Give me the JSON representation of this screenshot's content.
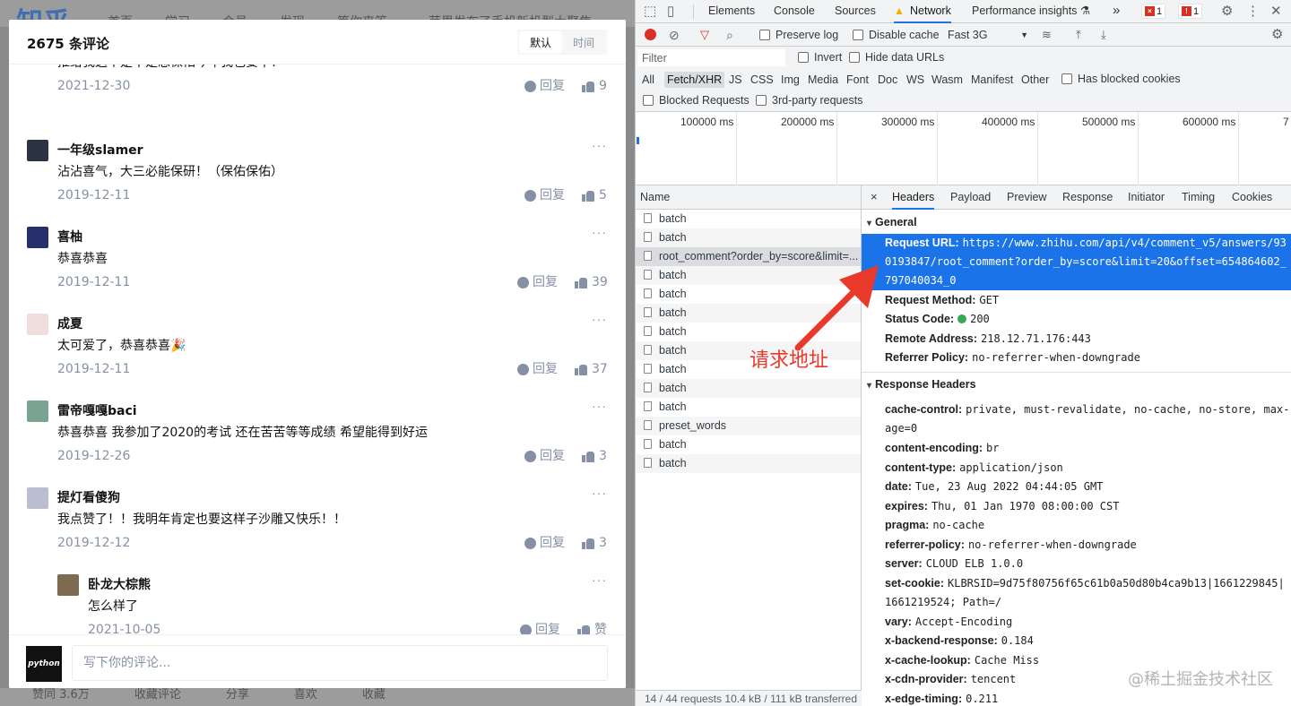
{
  "zhihu_bg": {
    "logo": "知乎",
    "nav": [
      "首页",
      "学习",
      "会员",
      "发现",
      "等你来答"
    ],
    "search_hint": "苹果发布了手机新机型大聚焦",
    "bottom": [
      "赞同 3.6万",
      "收藏评论",
      "分享",
      "喜欢",
      "收藏"
    ]
  },
  "comments_modal": {
    "title": "2675 条评论",
    "sort_default": "默认",
    "sort_time": "时间",
    "more": "···",
    "reply_label": "回复",
    "comments": [
      {
        "name": "",
        "text": "推给我这个是不是想保佑今年我也要中！",
        "date": "2021-12-30",
        "likes": "9",
        "avatar_color": "#ffffff"
      },
      {
        "name": "一年级slamer",
        "text": "沾沾喜气，大三必能保研！（保佑保佑）",
        "date": "2019-12-11",
        "likes": "5",
        "avatar_color": "#2b3240"
      },
      {
        "name": "喜柚",
        "text": "恭喜恭喜",
        "date": "2019-12-11",
        "likes": "39",
        "avatar_color": "#27306b"
      },
      {
        "name": "成夏",
        "text": "太可爱了，恭喜恭喜🎉",
        "date": "2019-12-11",
        "likes": "37",
        "avatar_color": "#f0dede"
      },
      {
        "name": "雷帝嘎嘎baci",
        "text": "恭喜恭喜 我参加了2020的考试 还在苦苦等等成绩 希望能得到好运",
        "date": "2019-12-26",
        "likes": "3",
        "avatar_color": "#7aa391"
      },
      {
        "name": "提灯看傻狗",
        "text": "我点赞了！！我明年肯定也要这样子沙雕又快乐！！",
        "date": "2019-12-12",
        "likes": "3",
        "avatar_color": "#b9bfd0"
      },
      {
        "name": "卧龙大棕熊",
        "text": "怎么样了",
        "date": "2021-10-05",
        "likes": "赞",
        "avatar_color": "#7d6a50"
      }
    ],
    "my_avatar_text": "python",
    "input_placeholder": "写下你的评论..."
  },
  "devtools": {
    "tabs": [
      "Elements",
      "Console",
      "Sources",
      "Network",
      "Performance insights ⚗"
    ],
    "active_tab": "Network",
    "overflow": "»",
    "errors": "1",
    "issues": "1",
    "toolbar": {
      "preserve_log": "Preserve log",
      "disable_cache": "Disable cache",
      "throttle": "Fast 3G"
    },
    "filter": {
      "placeholder": "Filter",
      "invert": "Invert",
      "hide_data_urls": "Hide data URLs",
      "types": [
        "All",
        "Fetch/XHR",
        "JS",
        "CSS",
        "Img",
        "Media",
        "Font",
        "Doc",
        "WS",
        "Wasm",
        "Manifest",
        "Other"
      ],
      "active_type": "Fetch/XHR",
      "has_blocked_cookies": "Has blocked cookies",
      "blocked_requests": "Blocked Requests",
      "third_party": "3rd-party requests"
    },
    "timeline_ticks": [
      "100000 ms",
      "200000 ms",
      "300000 ms",
      "400000 ms",
      "500000 ms",
      "600000 ms",
      "7"
    ],
    "name_header": "Name",
    "requests": [
      "batch",
      "batch",
      "root_comment?order_by=score&limit=...",
      "batch",
      "batch",
      "batch",
      "batch",
      "batch",
      "batch",
      "batch",
      "batch",
      "preset_words",
      "batch",
      "batch"
    ],
    "status_bar": "14 / 44 requests    10.4 kB / 111 kB transferred",
    "detail_tabs": [
      "×",
      "Headers",
      "Payload",
      "Preview",
      "Response",
      "Initiator",
      "Timing",
      "Cookies"
    ],
    "general_title": "General",
    "general": {
      "request_url_key": "Request URL:",
      "request_url": "https://www.zhihu.com/api/v4/comment_v5/answers/930193847/root_comment?order_by=score&limit=20&offset=654864602_797040034_0",
      "method_key": "Request Method:",
      "method": "GET",
      "status_key": "Status Code:",
      "status": "200",
      "remote_key": "Remote Address:",
      "remote": "218.12.71.176:443",
      "referrer_key": "Referrer Policy:",
      "referrer": "no-referrer-when-downgrade"
    },
    "response_title": "Response Headers",
    "response_headers": [
      {
        "k": "cache-control:",
        "v": "private, must-revalidate, no-cache, no-store, max-age=0"
      },
      {
        "k": "content-encoding:",
        "v": "br"
      },
      {
        "k": "content-type:",
        "v": "application/json"
      },
      {
        "k": "date:",
        "v": "Tue, 23 Aug 2022 04:44:05 GMT"
      },
      {
        "k": "expires:",
        "v": "Thu, 01 Jan 1970 08:00:00 CST"
      },
      {
        "k": "pragma:",
        "v": "no-cache"
      },
      {
        "k": "referrer-policy:",
        "v": "no-referrer-when-downgrade"
      },
      {
        "k": "server:",
        "v": "CLOUD ELB 1.0.0"
      },
      {
        "k": "set-cookie:",
        "v": "KLBRSID=9d75f80756f65c61b0a50d80b4ca9b13|1661229845|1661219524; Path=/"
      },
      {
        "k": "vary:",
        "v": "Accept-Encoding"
      },
      {
        "k": "x-backend-response:",
        "v": "0.184"
      },
      {
        "k": "x-cache-lookup:",
        "v": "Cache Miss"
      },
      {
        "k": "x-cdn-provider:",
        "v": "tencent"
      },
      {
        "k": "x-edge-timing:",
        "v": "0.211"
      }
    ]
  },
  "annotation": "请求地址",
  "watermark": "@稀土掘金技术社区",
  "colors": {
    "accent": "#1a73e8",
    "annotation": "#e8392b",
    "status_ok": "#34a853"
  }
}
